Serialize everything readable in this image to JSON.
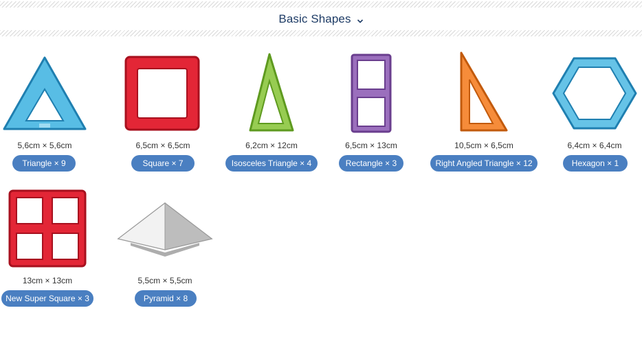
{
  "header": {
    "title": "Basic Shapes",
    "toggle_icon": "chevron-down-icon",
    "title_color": "#1e3c66"
  },
  "colors": {
    "pill_bg": "#4a7fc1",
    "pill_text": "#ffffff",
    "triangle": "#3bb1e0",
    "square": "#e32636",
    "isosceles": "#8cc63f",
    "rectangle": "#9b6fbd",
    "right_triangle": "#f58025",
    "hexagon": "#4bb8e3",
    "new_super_square": "#e32636",
    "pyramid": "#c8c8c8"
  },
  "items": [
    {
      "name": "Triangle",
      "count": "× 9",
      "dim": "5,6cm × 5,6cm",
      "label": "Triangle × 9"
    },
    {
      "name": "Square",
      "count": "× 7",
      "dim": "6,5cm × 6,5cm",
      "label": "Square × 7"
    },
    {
      "name": "Isosceles Triangle",
      "count": "× 4",
      "dim": "6,2cm × 12cm",
      "label": "Isosceles Triangle × 4"
    },
    {
      "name": "Rectangle",
      "count": "× 3",
      "dim": "6,5cm × 13cm",
      "label": "Rectangle × 3"
    },
    {
      "name": "Right Angled Triangle",
      "count": "× 12",
      "dim": "10,5cm × 6,5cm",
      "label": "Right Angled Triangle × 12"
    },
    {
      "name": "Hexagon",
      "count": "× 1",
      "dim": "6,4cm × 6,4cm",
      "label": "Hexagon × 1"
    },
    {
      "name": "New Super Square",
      "count": "× 3",
      "dim": "13cm × 13cm",
      "label": "New Super Square × 3"
    },
    {
      "name": "Pyramid",
      "count": "× 8",
      "dim": "5,5cm × 5,5cm",
      "label": "Pyramid × 8"
    }
  ]
}
